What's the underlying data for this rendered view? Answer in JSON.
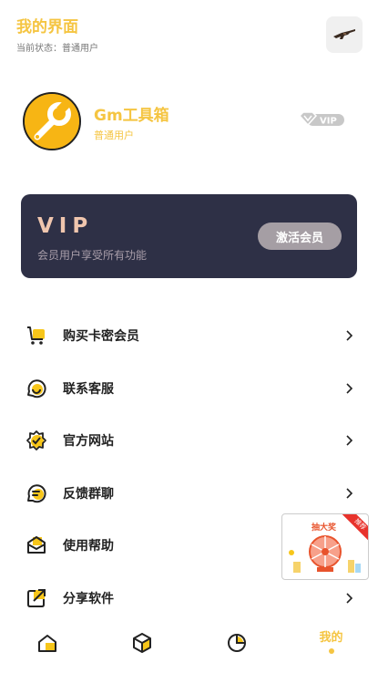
{
  "header": {
    "title": "我的界面",
    "subtitle": "当前状态：普通用户"
  },
  "profile": {
    "name": "Gm工具箱",
    "type": "普通用户",
    "badge": "VIP"
  },
  "vip_card": {
    "title": "VIP",
    "description": "会员用户享受所有功能",
    "button": "激活会员"
  },
  "menu": [
    {
      "label": "购买卡密会员",
      "icon": "cart-icon"
    },
    {
      "label": "联系客服",
      "icon": "customer-service-icon"
    },
    {
      "label": "官方网站",
      "icon": "website-badge-icon"
    },
    {
      "label": "反馈群聊",
      "icon": "chat-bubble-icon"
    },
    {
      "label": "使用帮助",
      "icon": "help-mail-icon"
    },
    {
      "label": "分享软件",
      "icon": "share-icon"
    }
  ],
  "promo": {
    "title": "抽大奖",
    "tag": "推荐"
  },
  "tabs": [
    {
      "name": "home",
      "icon": "home-icon"
    },
    {
      "name": "tools",
      "icon": "box-icon"
    },
    {
      "name": "stats",
      "icon": "pie-chart-icon"
    },
    {
      "name": "mine",
      "label": "我的"
    }
  ],
  "colors": {
    "accent": "#f5c542",
    "card": "#2e3046",
    "vip_text": "#f0c6ae"
  }
}
